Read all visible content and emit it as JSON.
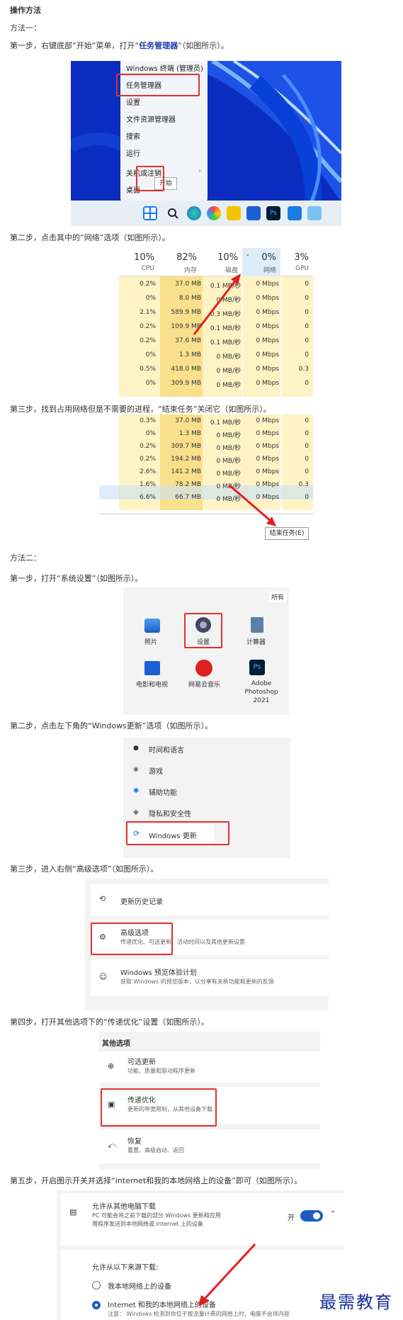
{
  "heading": "操作方法",
  "method1": "方法一：",
  "step1_1_pre": "第一步，右键底部“开始”菜单，打开“",
  "step1_1_bold": "任务管理器",
  "step1_1_post": "”（如图所示）。",
  "startmenu": {
    "items": [
      "Windows 终端 (管理员)",
      "任务管理器",
      "设置",
      "文件资源管理器",
      "搜索",
      "运行",
      "关机或注销",
      "桌面"
    ],
    "tooltip": "开始"
  },
  "step1_2": "第二步，点击其中的“网络”选项（如图所示）。",
  "tm_header": {
    "cols": [
      {
        "pct": "10%",
        "name": "CPU"
      },
      {
        "pct": "82%",
        "name": "内存"
      },
      {
        "pct": "10%",
        "name": "磁盘"
      },
      {
        "pct": "0%",
        "name": "网络"
      },
      {
        "pct": "3%",
        "name": "GPU"
      }
    ]
  },
  "tm_rows1": [
    [
      "0.2%",
      "37.0 MB",
      "0.1 MB/秒",
      "0 Mbps",
      "0"
    ],
    [
      "0%",
      "8.0 MB",
      "0 MB/秒",
      "0 Mbps",
      "0"
    ],
    [
      "2.1%",
      "589.9 MB",
      "0.3 MB/秒",
      "0 Mbps",
      "0"
    ],
    [
      "0.2%",
      "109.9 MB",
      "0.1 MB/秒",
      "0 Mbps",
      "0"
    ],
    [
      "0.2%",
      "37.6 MB",
      "0.1 MB/秒",
      "0 Mbps",
      "0"
    ],
    [
      "0%",
      "1.3 MB",
      "0 MB/秒",
      "0 Mbps",
      "0"
    ],
    [
      "0.5%",
      "418.0 MB",
      "0 MB/秒",
      "0 Mbps",
      "0.3"
    ],
    [
      "0%",
      "309.9 MB",
      "0 MB/秒",
      "0 Mbps",
      "0"
    ]
  ],
  "step1_3": "第三步，找到占用网络但是不需要的进程，“结束任务”关闭它（如图所示）。",
  "tm_rows2": [
    [
      "0.3%",
      "37.0 MB",
      "0.1 MB/秒",
      "0 Mbps",
      "0"
    ],
    [
      "0%",
      "1.3 MB",
      "0 MB/秒",
      "0 Mbps",
      "0"
    ],
    [
      "0.2%",
      "309.7 MB",
      "0 MB/秒",
      "0 Mbps",
      "0"
    ],
    [
      "0.2%",
      "194.2 MB",
      "0 MB/秒",
      "0 Mbps",
      "0"
    ],
    [
      "2.6%",
      "141.2 MB",
      "0 MB/秒",
      "0 Mbps",
      "0"
    ],
    [
      "1.6%",
      "78.2 MB",
      "0 MB/秒",
      "0 Mbps",
      "0.3"
    ],
    [
      "6.6%",
      "66.7 MB",
      "0 MB/秒",
      "0 Mbps",
      "0"
    ]
  ],
  "end_task": "结束任务(E)",
  "method2": "方法二：",
  "step2_1": "第一步，打开“系统设置”（如图所示）。",
  "apps": {
    "all": "所有",
    "items": [
      "照片",
      "设置",
      "计算器",
      "电影和电视",
      "网易云音乐",
      "Adobe Photoshop 2021"
    ],
    "ps": "Ps"
  },
  "step2_2": "第二步，点击左下角的“Windows更新”选项（如图所示）。",
  "nav": [
    "时间和语言",
    "游戏",
    "辅助功能",
    "隐私和安全性",
    "Windows 更新"
  ],
  "step2_3": "第三步，进入右侧“高级选项”（如图所示）。",
  "update_opts": [
    {
      "title": "更新历史记录",
      "desc": ""
    },
    {
      "title": "高级选项",
      "desc": "传递优化、可选更新、活动时间以及其他更新设置"
    },
    {
      "title": "Windows 预览体验计划",
      "desc": "获取 Windows 的预览版本，以分享有关新功能和更新的反馈"
    }
  ],
  "step2_4": "第四步，打开其他选项下的“传递优化”设置（如图所示）。",
  "other": {
    "title": "其他选项",
    "items": [
      {
        "title": "可选更新",
        "desc": "功能、质量和驱动程序更新"
      },
      {
        "title": "传递优化",
        "desc": "更新的带宽限制，从其他设备下载"
      },
      {
        "title": "恢复",
        "desc": "重置、高级启动、返回"
      }
    ]
  },
  "step2_5": "第五步，开启图示开关并选择“internet和我的本地网络上的设备”即可（如图所示）。",
  "delivery": {
    "title": "允许从其他电脑下载",
    "desc1": "PC 可能会将之前下载的部分 Windows 更新和应用",
    "desc2": "用程序发送到本地网络或 Internet 上的设备",
    "toggle": "开",
    "source": "允许从以下来源下载:",
    "opt1": "我本地网络上的设备",
    "opt2": "Internet 和我的本地网络上的设备",
    "note": "注意：",
    "note_rest": "Windows 检测到你位于按流量计费的网络上时，电脑不会将内容"
  },
  "watermark": "最需教育"
}
